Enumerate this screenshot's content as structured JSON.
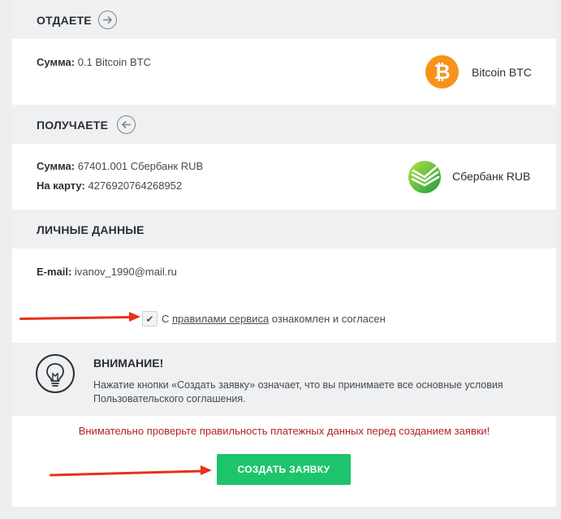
{
  "give": {
    "title": "ОТДАЕТЕ",
    "amount_label": "Сумма:",
    "amount_value": "0.1 Bitcoin BTC",
    "currency_name": "Bitcoin BTC",
    "currency_icon": "bitcoin-icon"
  },
  "receive": {
    "title": "ПОЛУЧАЕТЕ",
    "amount_label": "Сумма:",
    "amount_value": "67401.001 Сбербанк RUB",
    "card_label": "На карту:",
    "card_value": "4276920764268952",
    "currency_name": "Сбербанк RUB",
    "currency_icon": "sberbank-icon"
  },
  "personal": {
    "title": "ЛИЧНЫЕ ДАННЫЕ",
    "email_label": "E-mail:",
    "email_value": "ivanov_1990@mail.ru"
  },
  "agreement": {
    "checked": true,
    "prefix": "С",
    "link_text": "правилами сервиса",
    "suffix": "ознакомлен и согласен"
  },
  "attention": {
    "title": "ВНИМАНИЕ!",
    "text": "Нажатие кнопки «Создать заявку» означает, что вы принимаете все основные условия Пользовательского соглашения."
  },
  "warning": "Внимательно проверьте правильность платежных данных перед созданием заявки!",
  "submit_label": "СОЗДАТЬ ЗАЯВКУ",
  "colors": {
    "accent_green": "#1ec46b",
    "warning_red": "#b2222a",
    "arrow_red": "#e8311a",
    "bitcoin_orange": "#f7931a"
  }
}
